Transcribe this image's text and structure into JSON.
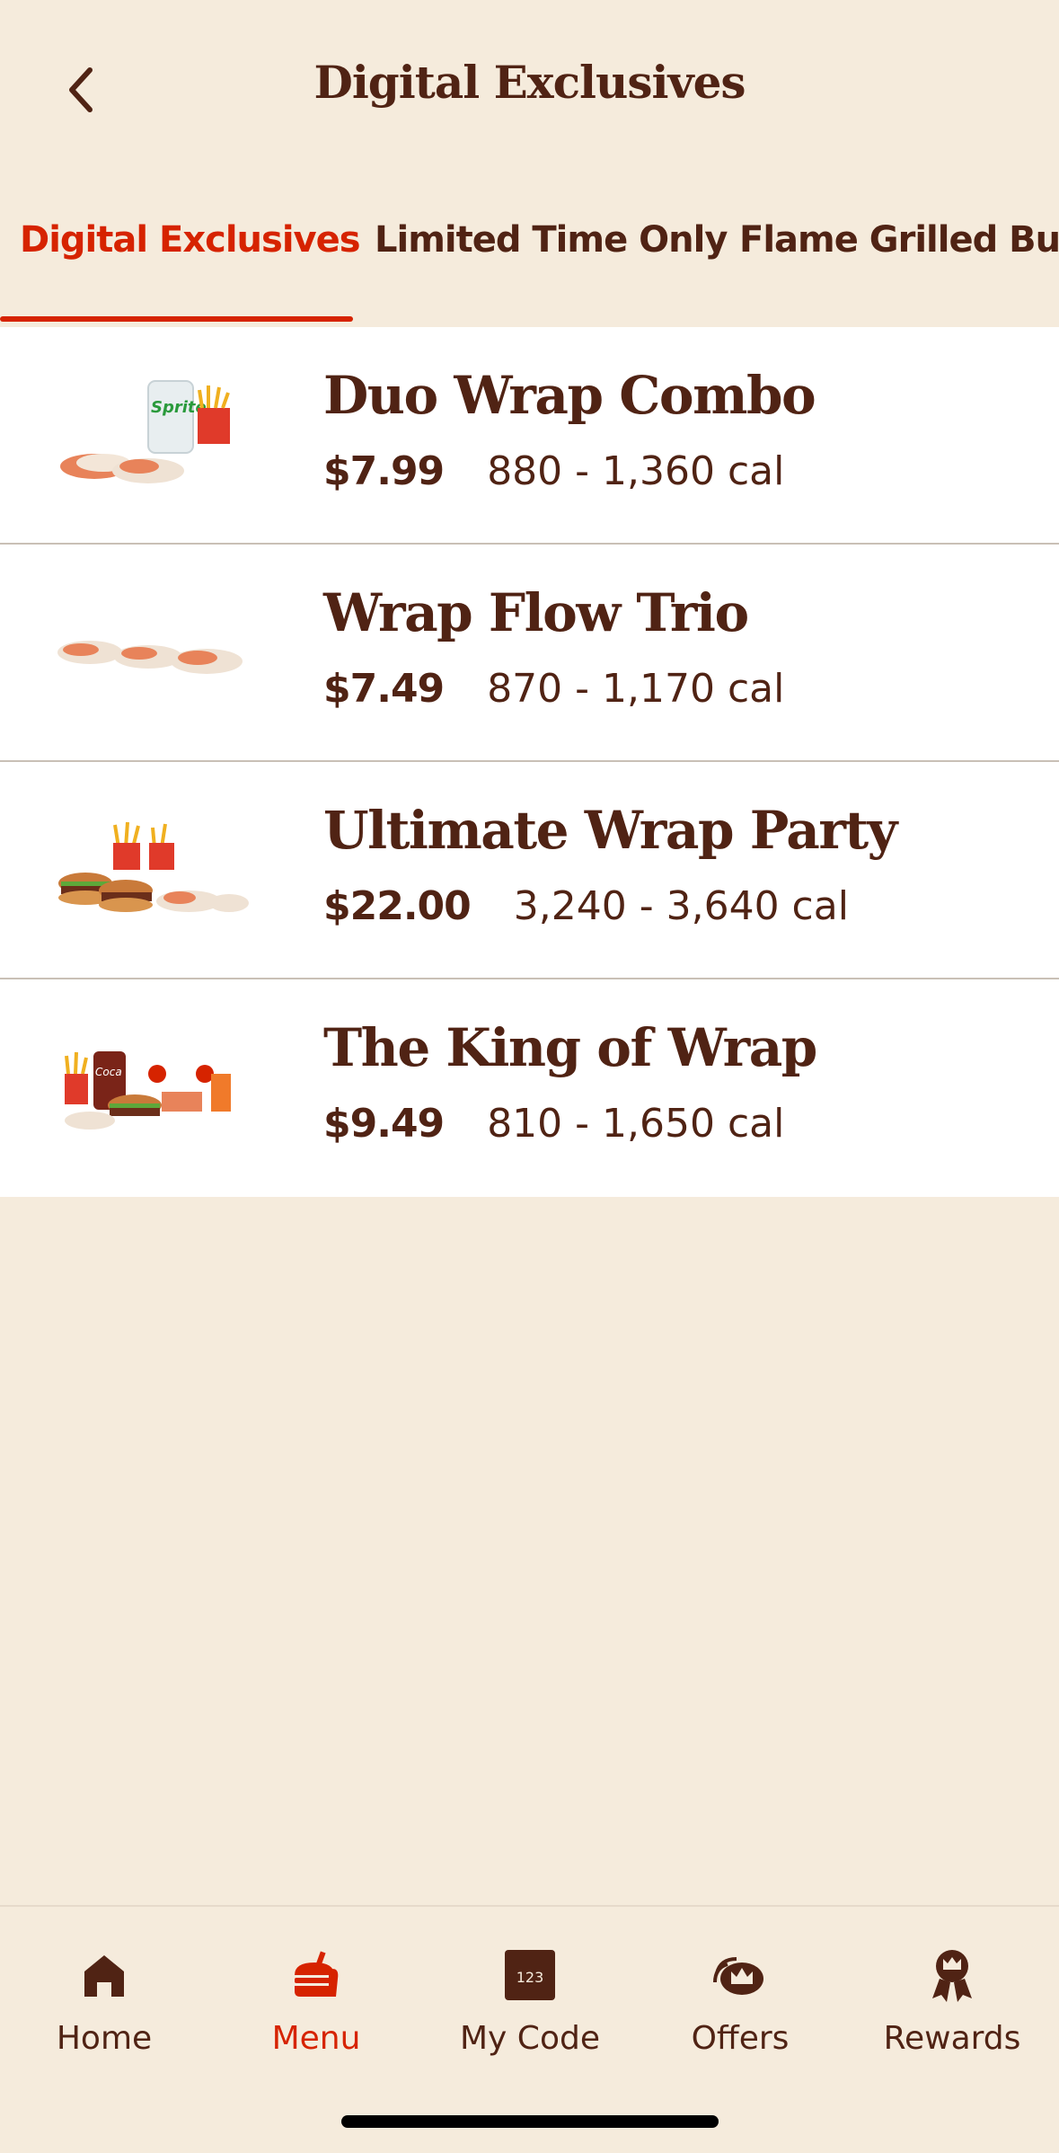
{
  "header": {
    "title": "Digital Exclusives",
    "back_icon": "chevron-left-icon"
  },
  "tabs": [
    {
      "label": "Digital Exclusives",
      "active": true
    },
    {
      "label": "Limited Time Only",
      "active": false
    },
    {
      "label": "Flame Grilled Burg",
      "active": false
    }
  ],
  "menu_items": [
    {
      "name": "Duo Wrap Combo",
      "price": "$7.99",
      "calories": "880 - 1,360 cal",
      "image": "duo-wrap-combo-image"
    },
    {
      "name": "Wrap Flow Trio",
      "price": "$7.49",
      "calories": "870 - 1,170 cal",
      "image": "wrap-flow-trio-image"
    },
    {
      "name": "Ultimate Wrap Party",
      "price": "$22.00",
      "calories": "3,240 - 3,640 cal",
      "image": "ultimate-wrap-party-image"
    },
    {
      "name": "The King of Wrap",
      "price": "$9.49",
      "calories": "810 - 1,650 cal",
      "image": "king-of-wrap-image"
    }
  ],
  "bottom_nav": [
    {
      "label": "Home",
      "icon": "home-icon",
      "active": false
    },
    {
      "label": "Menu",
      "icon": "menu-burger-icon",
      "active": true
    },
    {
      "label": "My Code",
      "icon": "code-icon",
      "icon_text": "123",
      "active": false
    },
    {
      "label": "Offers",
      "icon": "offers-crown-icon",
      "active": false
    },
    {
      "label": "Rewards",
      "icon": "rewards-ribbon-icon",
      "active": false
    }
  ],
  "colors": {
    "background": "#f5ebdc",
    "brand_brown": "#502314",
    "accent_red": "#d62300",
    "card": "#ffffff"
  }
}
